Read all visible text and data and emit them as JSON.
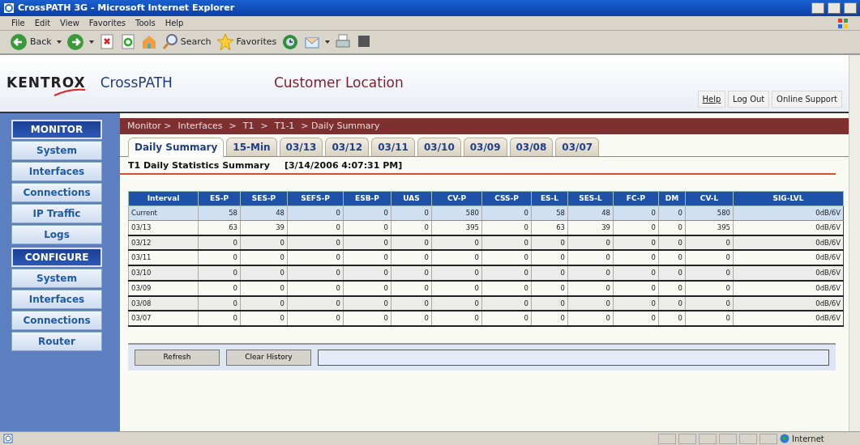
{
  "window": {
    "title": "CrossPATH 3G - Microsoft Internet Explorer"
  },
  "menu": [
    "File",
    "Edit",
    "View",
    "Favorites",
    "Tools",
    "Help"
  ],
  "toolbar": [
    {
      "kind": "back",
      "label": "Back"
    },
    {
      "kind": "forward"
    },
    {
      "kind": "stop"
    },
    {
      "kind": "refresh"
    },
    {
      "kind": "home"
    },
    {
      "kind": "search",
      "label": "Search"
    },
    {
      "kind": "favorites",
      "label": "Favorites"
    },
    {
      "kind": "history"
    },
    {
      "kind": "mail"
    },
    {
      "kind": "print"
    },
    {
      "kind": "edit"
    }
  ],
  "header": {
    "logo": "KENTROX",
    "product": "CrossPATH",
    "location": "Customer Location",
    "links": [
      "Help",
      "Log Out",
      "Online Support"
    ]
  },
  "sidebar": [
    {
      "heading": "MONITOR",
      "items": [
        "System",
        "Interfaces",
        "Connections",
        "IP Traffic",
        "Logs"
      ]
    },
    {
      "heading": "CONFIGURE",
      "items": [
        "System",
        "Interfaces",
        "Connections",
        "Router"
      ]
    }
  ],
  "breadcrumb": [
    "Monitor >",
    "Interfaces",
    ">",
    "T1",
    ">",
    "T1-1",
    "> Daily Summary"
  ],
  "tabs": [
    {
      "label": "Daily Summary",
      "selected": true
    },
    {
      "label": "15-Min",
      "selected": false
    },
    {
      "label": "03/13",
      "selected": false
    },
    {
      "label": "03/12",
      "selected": false
    },
    {
      "label": "03/11",
      "selected": false
    },
    {
      "label": "03/10",
      "selected": false
    },
    {
      "label": "03/09",
      "selected": false
    },
    {
      "label": "03/08",
      "selected": false
    },
    {
      "label": "03/07",
      "selected": false
    }
  ],
  "section": {
    "title": "T1 Daily Statistics Summary",
    "timestamp": "[3/14/2006 4:07:31 PM]"
  },
  "table": {
    "columns": [
      "Interval",
      "ES-P",
      "SES-P",
      "SEFS-P",
      "ESB-P",
      "UAS",
      "CV-P",
      "CSS-P",
      "ES-L",
      "SES-L",
      "FC-P",
      "DM",
      "CV-L",
      "SIG-LVL"
    ],
    "rows": [
      {
        "highlighted": true,
        "cells": [
          "Current",
          "58",
          "48",
          "0",
          "0",
          "0",
          "580",
          "0",
          "58",
          "48",
          "0",
          "0",
          "580",
          "0dB/6V"
        ]
      },
      {
        "highlighted": false,
        "cells": [
          "03/13",
          "63",
          "39",
          "0",
          "0",
          "0",
          "395",
          "0",
          "63",
          "39",
          "0",
          "0",
          "395",
          "0dB/6V"
        ]
      },
      {
        "highlighted": false,
        "cells": [
          "03/12",
          "0",
          "0",
          "0",
          "0",
          "0",
          "0",
          "0",
          "0",
          "0",
          "0",
          "0",
          "0",
          "0dB/6V"
        ]
      },
      {
        "highlighted": false,
        "cells": [
          "03/11",
          "0",
          "0",
          "0",
          "0",
          "0",
          "0",
          "0",
          "0",
          "0",
          "0",
          "0",
          "0",
          "0dB/6V"
        ]
      },
      {
        "highlighted": false,
        "cells": [
          "03/10",
          "0",
          "0",
          "0",
          "0",
          "0",
          "0",
          "0",
          "0",
          "0",
          "0",
          "0",
          "0",
          "0dB/6V"
        ]
      },
      {
        "highlighted": false,
        "cells": [
          "03/09",
          "0",
          "0",
          "0",
          "0",
          "0",
          "0",
          "0",
          "0",
          "0",
          "0",
          "0",
          "0",
          "0dB/6V"
        ]
      },
      {
        "highlighted": false,
        "cells": [
          "03/08",
          "0",
          "0",
          "0",
          "0",
          "0",
          "0",
          "0",
          "0",
          "0",
          "0",
          "0",
          "0",
          "0dB/6V"
        ]
      },
      {
        "highlighted": false,
        "cells": [
          "03/07",
          "0",
          "0",
          "0",
          "0",
          "0",
          "0",
          "0",
          "0",
          "0",
          "0",
          "0",
          "0",
          "0dB/6V"
        ]
      }
    ]
  },
  "buttons": [
    "Refresh",
    "Clear History"
  ],
  "status_bar": {
    "zone": "Internet"
  }
}
